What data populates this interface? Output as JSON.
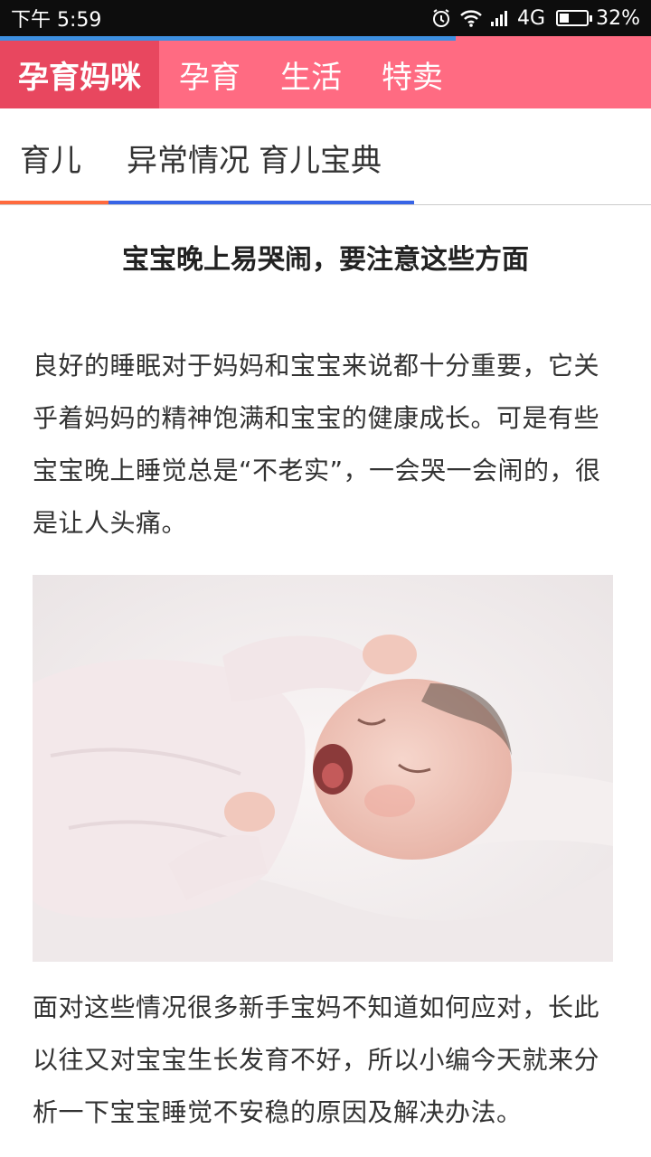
{
  "status_bar": {
    "time": "下午 5:59",
    "network": "4G",
    "battery": "32%",
    "battery_level": 0.32
  },
  "page_load_progress": 0.7,
  "top_nav": {
    "brand": "孕育妈咪",
    "tabs": [
      "孕育",
      "生活",
      "特卖"
    ]
  },
  "sub_tabs": {
    "items": [
      "育儿",
      "异常情况",
      "育儿宝典"
    ],
    "active_index": 1
  },
  "article": {
    "title": "宝宝晚上易哭闹，要注意这些方面",
    "paragraph_1": "良好的睡眠对于妈妈和宝宝来说都十分重要，它关乎着妈妈的精神饱满和宝宝的健康成长。可是有些宝宝晚上睡觉总是“不老实”，一会哭一会闹的，很是让人头痛。",
    "image_icon": "crying-baby-photo",
    "paragraph_2": "面对这些情况很多新手宝妈不知道如何应对，长此以往又对宝宝生长发育不好，所以小编今天就来分析一下宝宝睡觉不安稳的原因及解决办法。"
  },
  "colors": {
    "header_pink": "#ff6b82",
    "brand_pink_dark": "#e8475f",
    "tab_underline_orange": "#ff6a3d",
    "tab_underline_blue": "#3764e6",
    "progress_blue": "#3d8fe0"
  }
}
